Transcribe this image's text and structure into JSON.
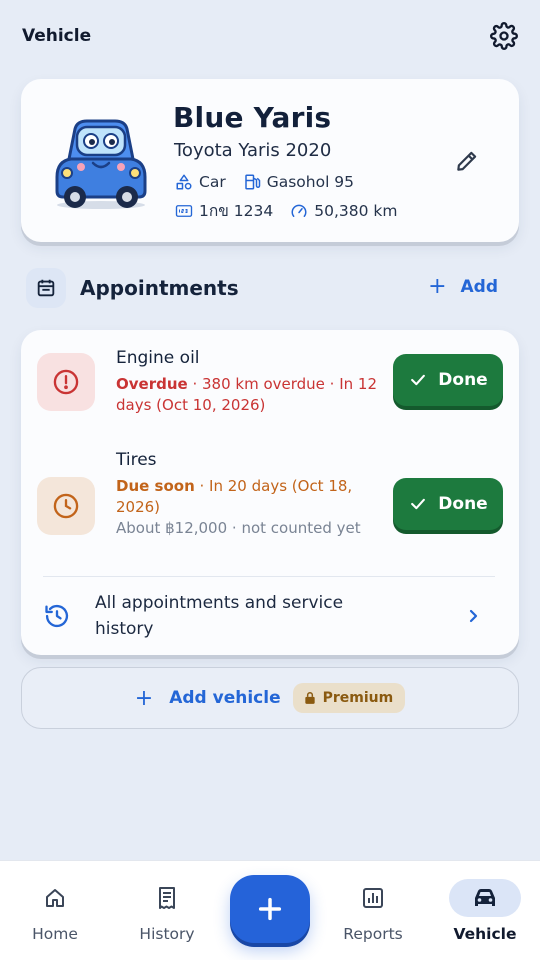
{
  "header": {
    "title": "Vehicle"
  },
  "vehicle": {
    "name": "Blue Yaris",
    "model": "Toyota Yaris 2020",
    "type": "Car",
    "fuel": "Gasohol 95",
    "plate": "1กข 1234",
    "odometer": "50,380 km"
  },
  "appointments": {
    "title": "Appointments",
    "add_label": "Add",
    "items": [
      {
        "name": "Engine oil",
        "status": "Overdue",
        "detail": " · 380 km overdue · In 12 days (Oct 10, 2026)",
        "status_color": "#c93434",
        "done_label": "Done"
      },
      {
        "name": "Tires",
        "status": "Due soon",
        "detail": " · In 20 days (Oct 18, 2026)",
        "sub": "About ฿12,000 · not counted yet",
        "status_color": "#c2641a",
        "done_label": "Done"
      }
    ],
    "history_label": "All appointments and service history"
  },
  "add_vehicle": {
    "label": "Add vehicle",
    "badge": "Premium"
  },
  "nav": {
    "home": "Home",
    "history": "History",
    "reports": "Reports",
    "vehicle": "Vehicle",
    "active": "vehicle"
  },
  "colors": {
    "accent": "#2563d9",
    "done_green": "#1d7a3e",
    "background": "#e6ecf6"
  }
}
